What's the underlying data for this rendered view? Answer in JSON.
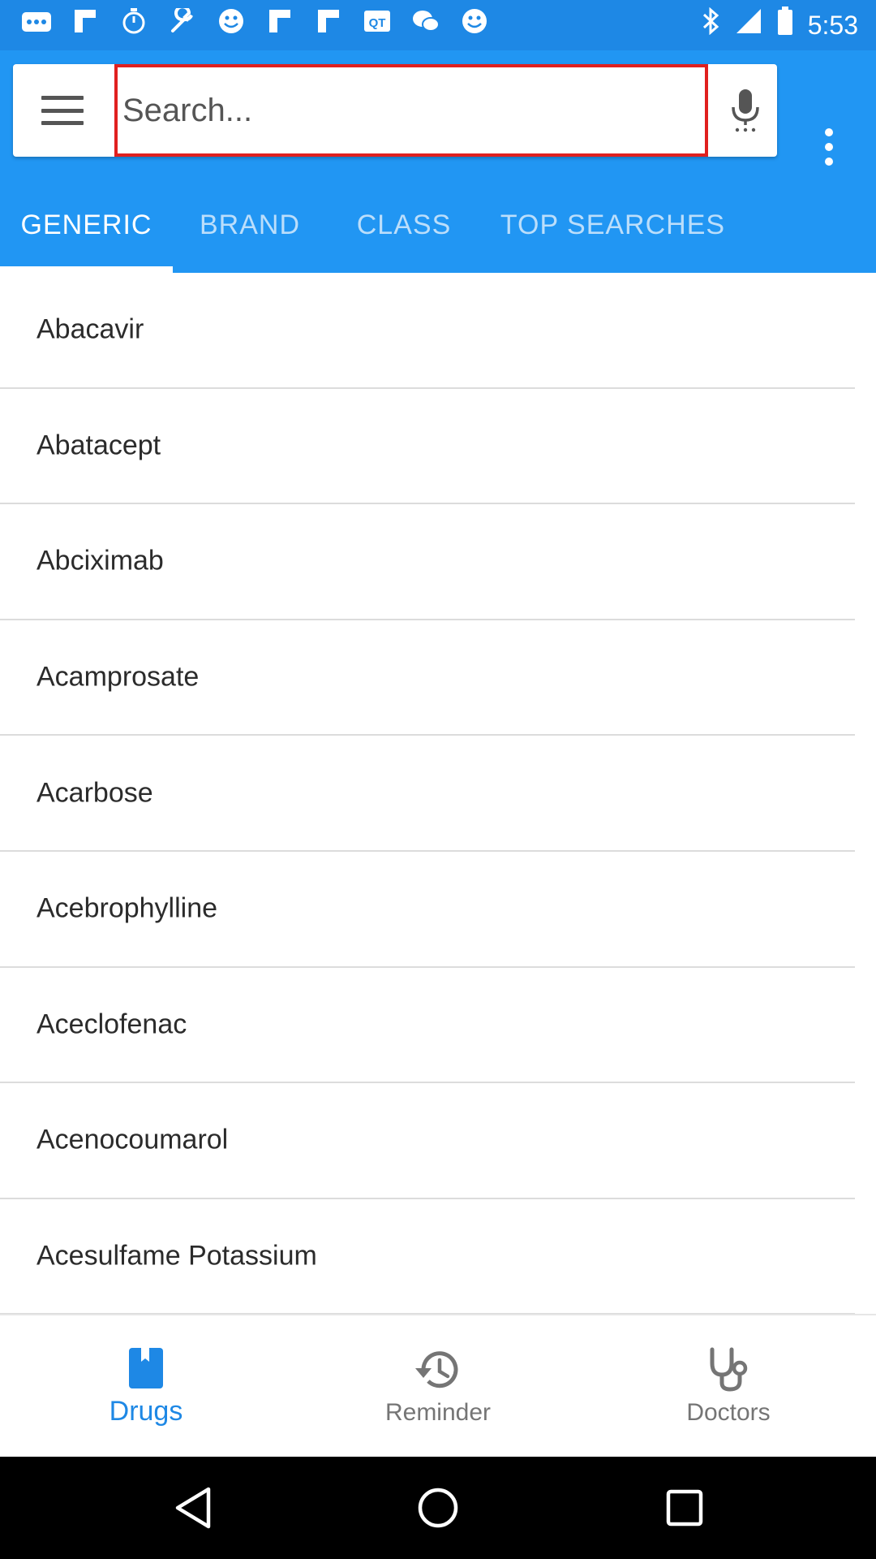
{
  "status_bar": {
    "left_icons": [
      "messages-icon",
      "flipboard-icon",
      "timer-icon",
      "wrench-icon",
      "smiley-icon",
      "flipboard-icon",
      "flipboard-icon",
      "qq-icon",
      "wechat-icon",
      "smiley-icon"
    ],
    "right_icons": [
      "bluetooth-icon",
      "signal-icon",
      "battery-icon"
    ],
    "time": "5:53"
  },
  "search": {
    "placeholder": "Search..."
  },
  "tabs": [
    {
      "label": "GENERIC",
      "active": true
    },
    {
      "label": "BRAND",
      "active": false
    },
    {
      "label": "CLASS",
      "active": false
    },
    {
      "label": "TOP SEARCHES",
      "active": false
    }
  ],
  "drugs": [
    "Abacavir",
    "Abatacept",
    "Abciximab",
    "Acamprosate",
    "Acarbose",
    "Acebrophylline",
    "Aceclofenac",
    "Acenocoumarol",
    "Acesulfame Potassium"
  ],
  "bottom_nav": [
    {
      "label": "Drugs",
      "icon": "book-icon",
      "active": true
    },
    {
      "label": "Reminder",
      "icon": "history-icon",
      "active": false
    },
    {
      "label": "Doctors",
      "icon": "stethoscope-icon",
      "active": false
    }
  ],
  "colors": {
    "primary": "#2196f3",
    "status_bar": "#1e88e5",
    "accent_active": "#1e88e5",
    "search_border": "#e0201f"
  }
}
